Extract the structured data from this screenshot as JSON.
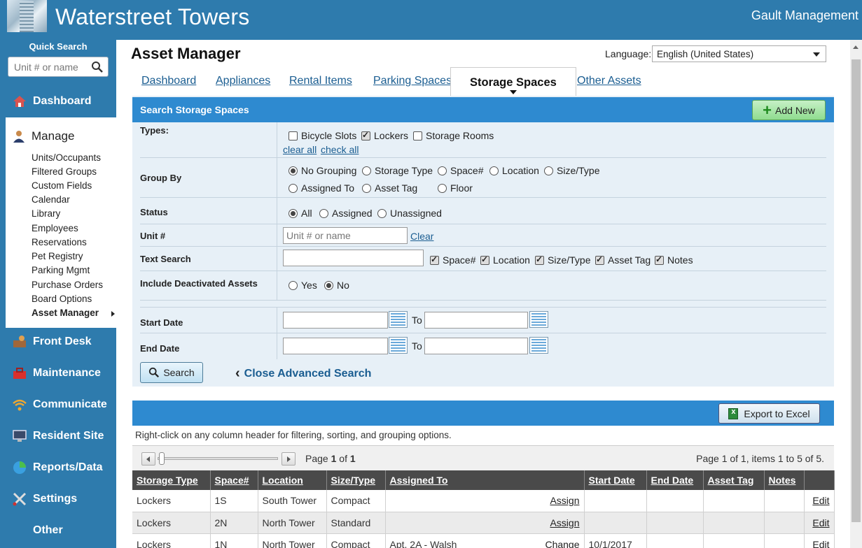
{
  "header": {
    "site_title": "Waterstreet Towers",
    "company": "Gault Management"
  },
  "sidebar": {
    "quick_search_label": "Quick Search",
    "quick_search_placeholder": "Unit # or name",
    "items": [
      {
        "label": "Dashboard",
        "icon": "house-icon"
      },
      {
        "label": "Front Desk",
        "icon": "desk-icon"
      },
      {
        "label": "Maintenance",
        "icon": "toolbox-icon"
      },
      {
        "label": "Communicate",
        "icon": "wifi-icon"
      },
      {
        "label": "Resident Site",
        "icon": "monitor-icon"
      },
      {
        "label": "Reports/Data",
        "icon": "pie-chart-icon"
      },
      {
        "label": "Settings",
        "icon": "tools-icon"
      },
      {
        "label": "Other",
        "icon": ""
      }
    ],
    "manage": {
      "title": "Manage",
      "items": [
        "Units/Occupants",
        "Filtered Groups",
        "Custom Fields",
        "Calendar",
        "Library",
        "Employees",
        "Reservations",
        "Pet Registry",
        "Parking Mgmt",
        "Purchase Orders",
        "Board Options",
        "Asset Manager"
      ],
      "active": "Asset Manager"
    }
  },
  "page": {
    "title": "Asset Manager",
    "language_label": "Language:",
    "language_value": "English (United States)"
  },
  "tabs": [
    {
      "label": "Dashboard"
    },
    {
      "label": "Appliances"
    },
    {
      "label": "Rental Items"
    },
    {
      "label": "Parking Spaces"
    },
    {
      "label": "Storage Spaces",
      "active": true
    },
    {
      "label": "Other Assets"
    }
  ],
  "search": {
    "title": "Search Storage Spaces",
    "add_new": "Add New",
    "types_label": "Types:",
    "types": [
      {
        "label": "Bicycle Slots",
        "checked": false
      },
      {
        "label": "Lockers",
        "checked": true
      },
      {
        "label": "Storage Rooms",
        "checked": false
      }
    ],
    "clear_all": "clear all",
    "check_all": "check all",
    "group_by_label": "Group By",
    "group_by": [
      {
        "label": "No Grouping",
        "checked": true
      },
      {
        "label": "Storage Type",
        "checked": false
      },
      {
        "label": "Space#",
        "checked": false
      },
      {
        "label": "Location",
        "checked": false
      },
      {
        "label": "Size/Type",
        "checked": false
      },
      {
        "label": "Assigned To",
        "checked": false
      },
      {
        "label": "Asset Tag",
        "checked": false
      },
      {
        "label": "Floor",
        "checked": false
      }
    ],
    "status_label": "Status",
    "status": [
      {
        "label": "All",
        "checked": true
      },
      {
        "label": "Assigned",
        "checked": false
      },
      {
        "label": "Unassigned",
        "checked": false
      }
    ],
    "unit_label": "Unit #",
    "unit_placeholder": "Unit # or name",
    "unit_clear": "Clear",
    "text_search_label": "Text Search",
    "text_fields": [
      {
        "label": "Space#",
        "checked": true
      },
      {
        "label": "Location",
        "checked": true
      },
      {
        "label": "Size/Type",
        "checked": true
      },
      {
        "label": "Asset Tag",
        "checked": true
      },
      {
        "label": "Notes",
        "checked": true
      }
    ],
    "deactivated_label": "Include Deactivated Assets",
    "deactivated": [
      {
        "label": "Yes",
        "checked": false
      },
      {
        "label": "No",
        "checked": true
      }
    ],
    "start_date_label": "Start Date",
    "end_date_label": "End Date",
    "to_label": "To",
    "search_button": "Search",
    "close_advanced": "Close Advanced Search"
  },
  "grid": {
    "export": "Export to Excel",
    "hint": "Right-click on any column header for filtering, sorting, and grouping options.",
    "page_label": "Page",
    "page_current": "1",
    "page_of": "of",
    "page_total": "1",
    "page_summary": "Page 1 of 1, items 1 to 5 of 5.",
    "columns": [
      "Storage Type",
      "Space#",
      "Location",
      "Size/Type",
      "Assigned To",
      "Start Date",
      "End Date",
      "Asset Tag",
      "Notes",
      ""
    ],
    "rows": [
      {
        "type": "Lockers",
        "space": "1S",
        "location": "South Tower",
        "size": "Compact",
        "assigned": "",
        "action": "Assign",
        "start": "",
        "end": "",
        "tag": "",
        "notes": "",
        "edit": "Edit"
      },
      {
        "type": "Lockers",
        "space": "2N",
        "location": "North Tower",
        "size": "Standard",
        "assigned": "",
        "action": "Assign",
        "start": "",
        "end": "",
        "tag": "",
        "notes": "",
        "edit": "Edit"
      },
      {
        "type": "Lockers",
        "space": "1N",
        "location": "North Tower",
        "size": "Compact",
        "assigned": "Apt. 2A - Walsh",
        "action": "Change",
        "start": "10/1/2017",
        "end": "",
        "tag": "",
        "notes": "",
        "edit": "Edit"
      }
    ]
  }
}
